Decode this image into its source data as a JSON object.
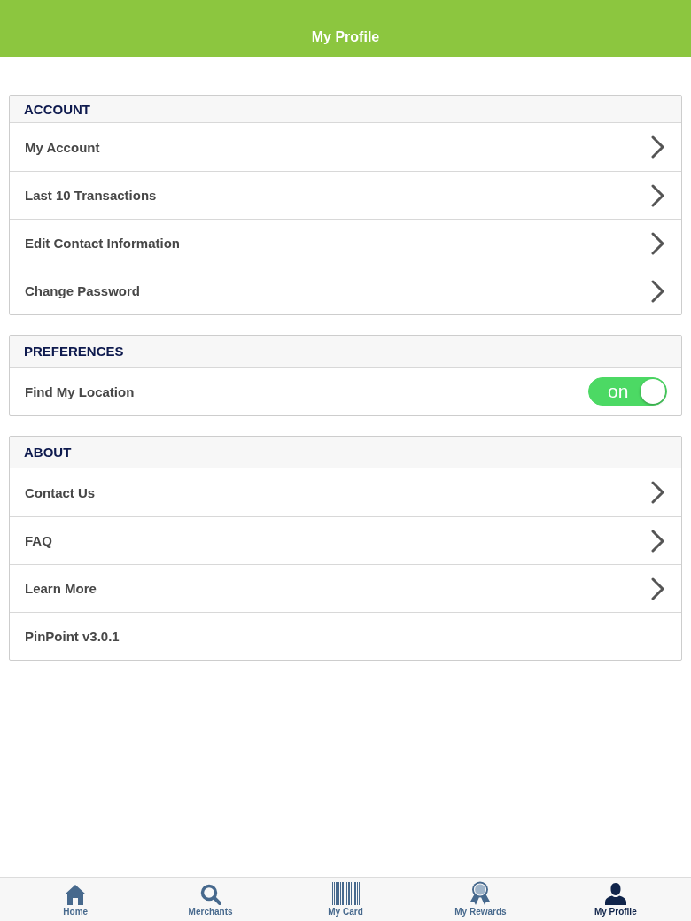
{
  "header": {
    "title": "My Profile"
  },
  "sections": [
    {
      "title": "ACCOUNT",
      "items": [
        {
          "kind": "link",
          "label": "My Account"
        },
        {
          "kind": "link",
          "label": "Last 10 Transactions"
        },
        {
          "kind": "link",
          "label": "Edit Contact Information"
        },
        {
          "kind": "link",
          "label": "Change Password"
        }
      ]
    },
    {
      "title": "PREFERENCES",
      "items": [
        {
          "kind": "toggle",
          "label": "Find My Location",
          "on": true,
          "toggle_text": "on"
        }
      ]
    },
    {
      "title": "ABOUT",
      "items": [
        {
          "kind": "link",
          "label": "Contact Us"
        },
        {
          "kind": "link",
          "label": "FAQ"
        },
        {
          "kind": "link",
          "label": "Learn More"
        },
        {
          "kind": "text",
          "label": "PinPoint v3.0.1"
        }
      ]
    }
  ],
  "tab_bar": {
    "tabs": [
      {
        "label": "Home",
        "selected": false
      },
      {
        "label": "Merchants",
        "selected": false
      },
      {
        "label": "My Card",
        "selected": false
      },
      {
        "label": "My Rewards",
        "selected": false
      },
      {
        "label": "My Profile",
        "selected": true
      }
    ]
  }
}
